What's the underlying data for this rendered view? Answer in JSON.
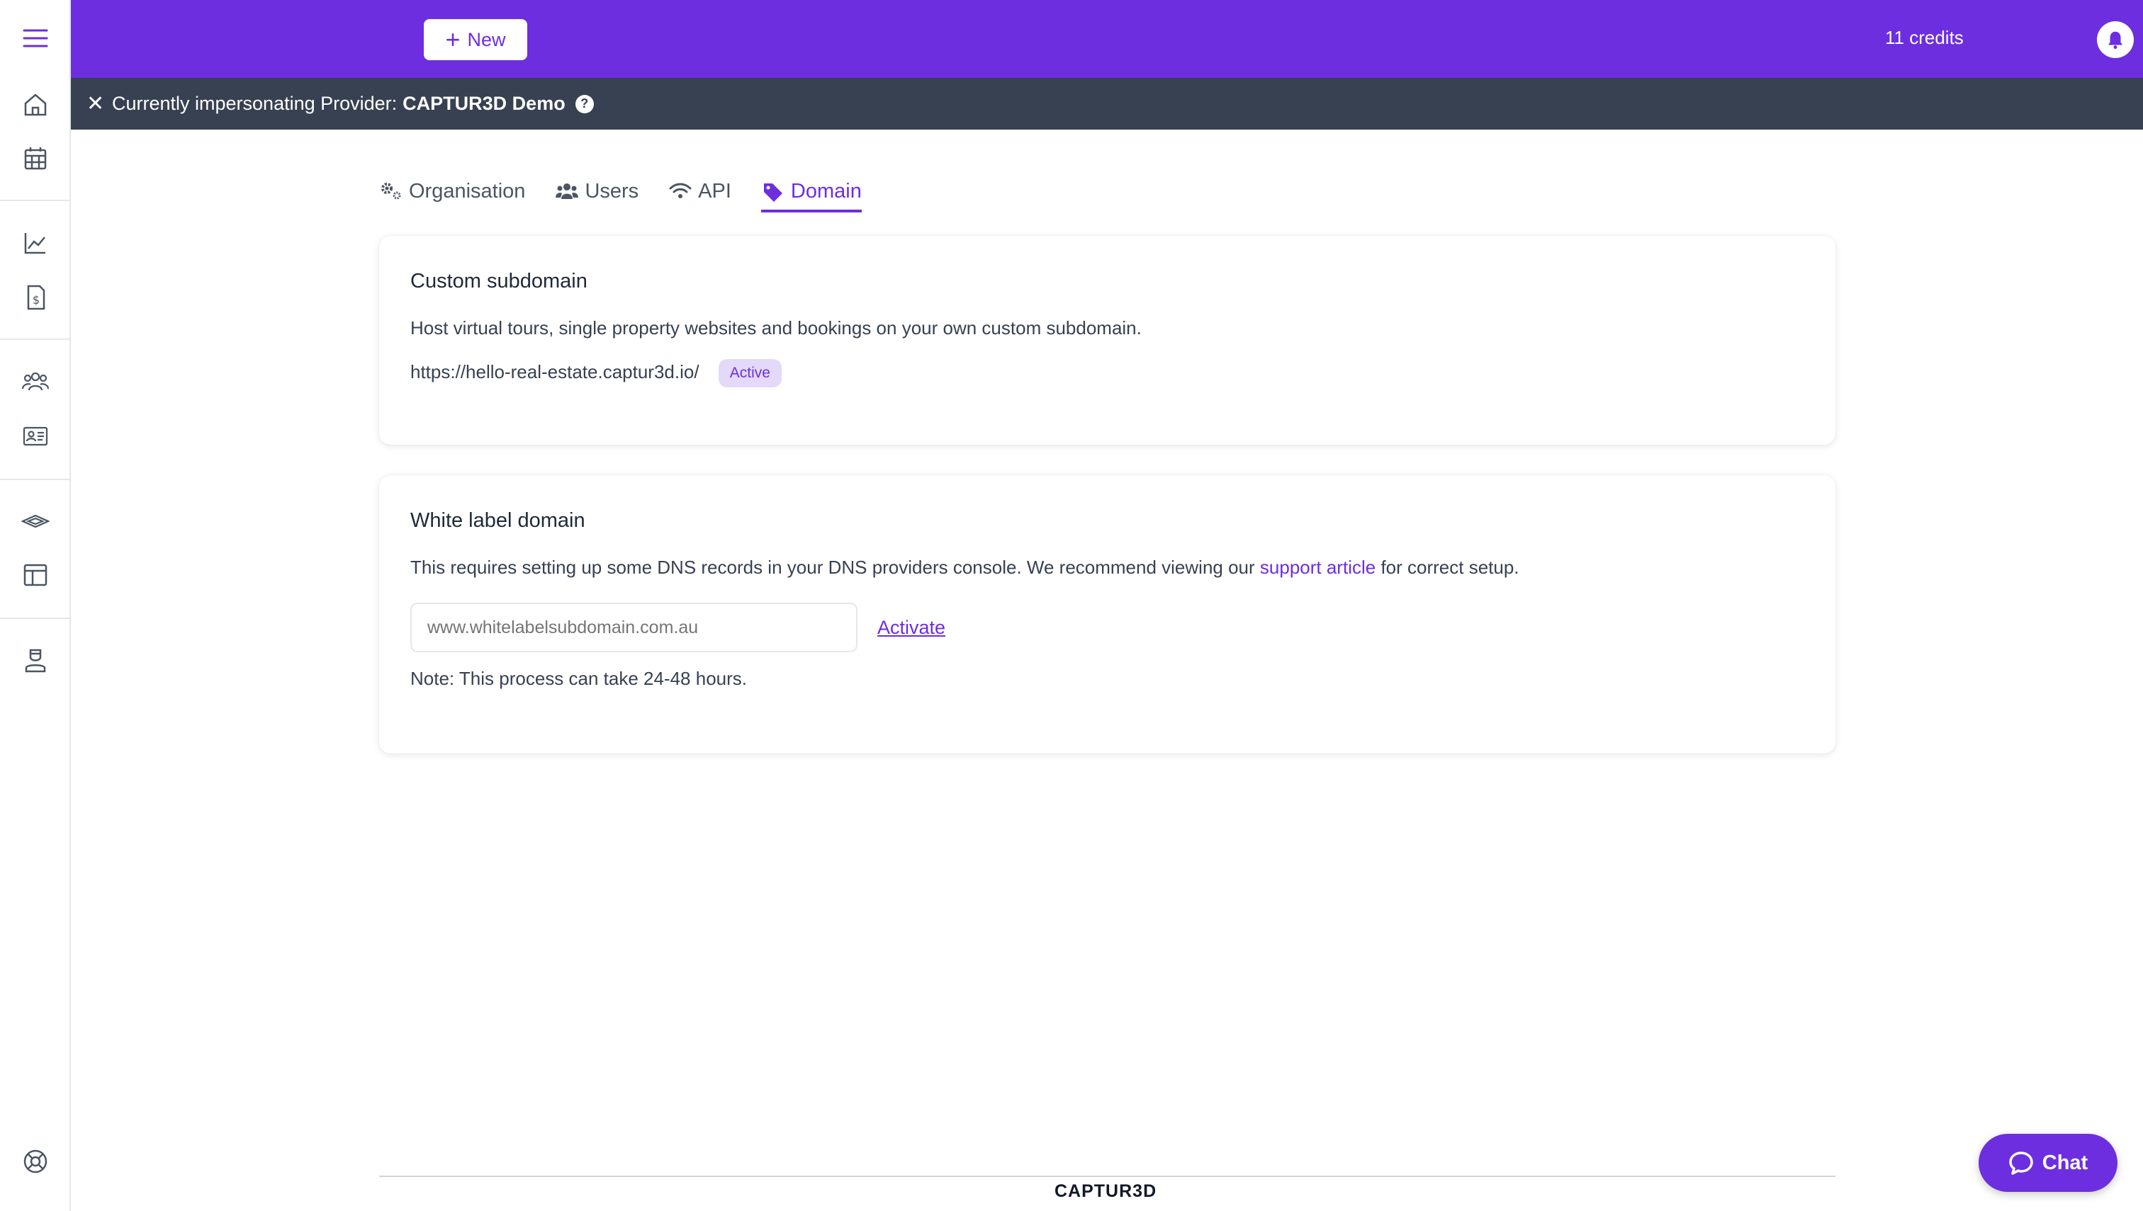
{
  "topbar": {
    "new_label": "New",
    "credits": "11 credits"
  },
  "impersonation": {
    "prefix": "Currently impersonating Provider:",
    "provider_name": "CAPTUR3D Demo",
    "help": "?"
  },
  "tabs": [
    {
      "label": "Organisation",
      "icon": "cogs-icon",
      "active": false
    },
    {
      "label": "Users",
      "icon": "users-icon",
      "active": false
    },
    {
      "label": "API",
      "icon": "wifi-icon",
      "active": false
    },
    {
      "label": "Domain",
      "icon": "tag-icon",
      "active": true
    }
  ],
  "custom_subdomain": {
    "title": "Custom subdomain",
    "description": "Host virtual tours, single property websites and bookings on your own custom subdomain.",
    "url": "https://hello-real-estate.captur3d.io/",
    "status": "Active"
  },
  "white_label": {
    "title": "White label domain",
    "description_before": "This requires setting up some DNS records in your DNS providers console. We recommend viewing our",
    "link_text": "support article",
    "description_after": "for correct setup.",
    "input_placeholder": "www.whitelabelsubdomain.com.au",
    "activate_label": "Activate",
    "note": "Note: This process can take 24-48 hours."
  },
  "footer": {
    "brand": "CAPTUR3D"
  },
  "chat": {
    "label": "Chat"
  },
  "colors": {
    "brand": "#6d2ee0",
    "impersonation_bar": "#374151"
  }
}
